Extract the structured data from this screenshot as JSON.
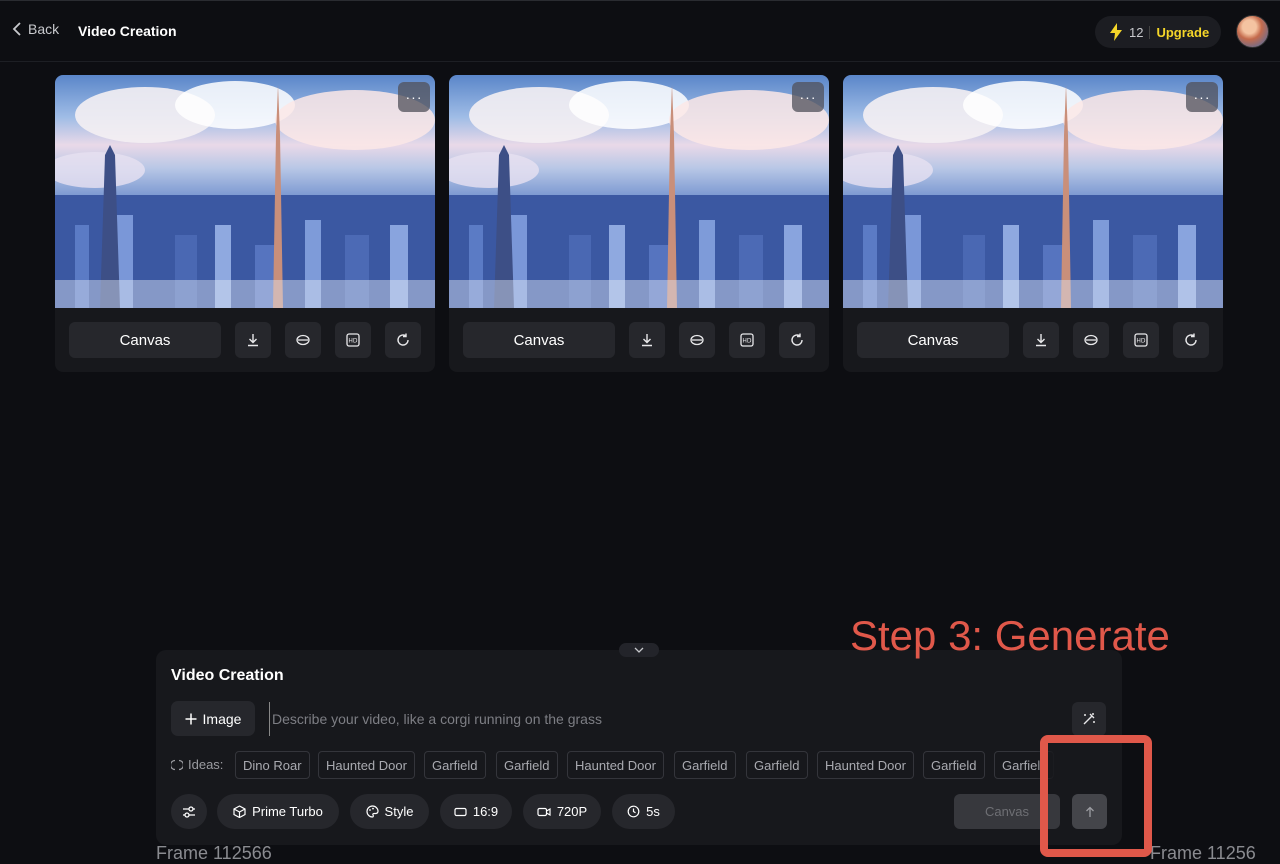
{
  "header": {
    "back_label": "Back",
    "title": "Video Creation",
    "credits": "12",
    "upgrade_label": "Upgrade"
  },
  "cards": [
    {
      "canvas_label": "Canvas",
      "more_label": "···"
    },
    {
      "canvas_label": "Canvas",
      "more_label": "···"
    },
    {
      "canvas_label": "Canvas",
      "more_label": "···"
    }
  ],
  "panel": {
    "title": "Video Creation",
    "image_button": "Image",
    "prompt_placeholder": "Describe your video, like a corgi running on the grass",
    "ideas_label": "Ideas:",
    "ideas": [
      "Dino Roar",
      "Haunted Door",
      "Garfield",
      "Garfield",
      "Haunted Door",
      "Garfield",
      "Garfield",
      "Haunted Door",
      "Garfield",
      "Garfield"
    ],
    "model": "Prime Turbo",
    "style": "Style",
    "ratio": "16:9",
    "resolution": "720P",
    "duration": "5s",
    "canvas_button": "Canvas"
  },
  "annotation": {
    "text": "Step 3: Generate",
    "color": "#e0584a"
  },
  "frame_labels": [
    "Frame 112566",
    "Frame 11256"
  ],
  "colors": {
    "background": "#0d0e12",
    "accent_upgrade": "#f5d629",
    "card": "#17181c"
  }
}
